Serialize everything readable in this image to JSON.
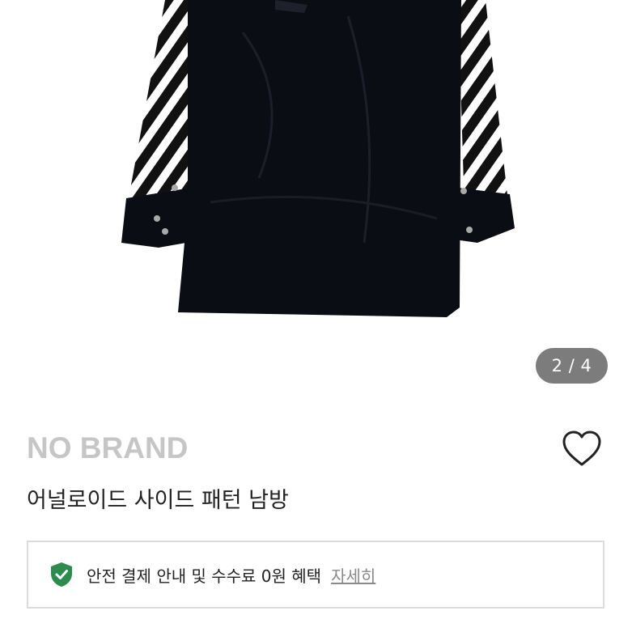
{
  "product": {
    "image_pager": "2 / 4",
    "brand": "NO BRAND",
    "title": "어널로이드 사이드 패턴 남방"
  },
  "safe_payment": {
    "text": "안전 결제 안내 및 수수료 0원 혜택",
    "link": "자세히"
  },
  "icons": {
    "like": "heart-outline-icon",
    "safe": "shield-check-icon"
  },
  "colors": {
    "brand_text": "#c6c6c6",
    "shield": "#2e8b4e",
    "pager_bg": "#7c7c7c"
  }
}
